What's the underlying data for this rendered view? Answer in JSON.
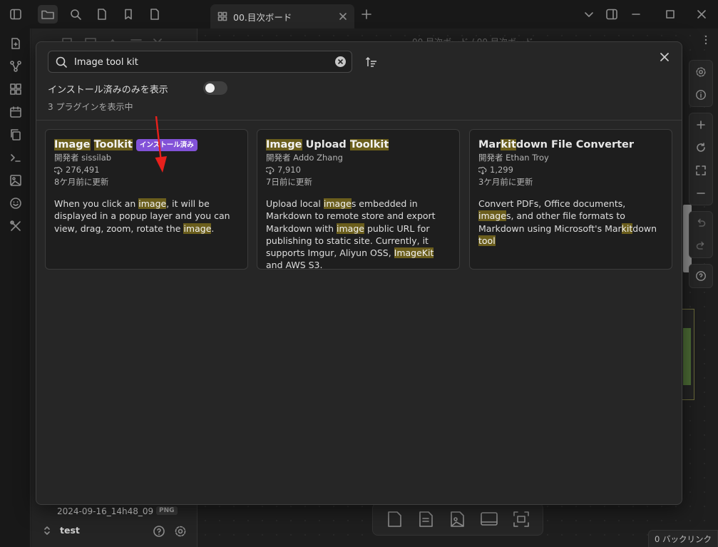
{
  "tabbar": {
    "tab_title": "00.目次ボード"
  },
  "sidebar": {
    "file_name": "2024-09-16_14h48_09",
    "file_badge": "PNG",
    "vault_name": "test"
  },
  "editor": {
    "breadcrumb": "00.目次ボード / 00.目次ボード",
    "backlinks": "0 バックリンク"
  },
  "plugin_browser": {
    "search": {
      "value": "Image tool kit",
      "placeholder": ""
    },
    "installed_only_label": "インストール済みのみを表示",
    "installed_only_enabled": false,
    "count_text": "3 プラグインを表示中",
    "plugins": [
      {
        "title_parts": [
          {
            "text": "Image",
            "hl": true
          },
          {
            "text": " ",
            "hl": false
          },
          {
            "text": "Toolkit",
            "hl": true
          }
        ],
        "installed_badge": "インストール済み",
        "author": "開発者 sissilab",
        "downloads": "276,491",
        "updated": "8ケ月前に更新",
        "description_parts": [
          {
            "text": "When you click an ",
            "hl": false
          },
          {
            "text": "image",
            "hl": true
          },
          {
            "text": ", it will be displayed in a popup layer and you can view, drag, zoom, rotate the ",
            "hl": false
          },
          {
            "text": "image",
            "hl": true
          },
          {
            "text": ".",
            "hl": false
          }
        ]
      },
      {
        "title_parts": [
          {
            "text": "Image",
            "hl": true
          },
          {
            "text": " Upload ",
            "hl": false
          },
          {
            "text": "Toolkit",
            "hl": true
          }
        ],
        "installed_badge": "",
        "author": "開発者 Addo Zhang",
        "downloads": "7,910",
        "updated": "7日前に更新",
        "description_parts": [
          {
            "text": "Upload local ",
            "hl": false
          },
          {
            "text": "image",
            "hl": true
          },
          {
            "text": "s embedded in Markdown to remote store and export Markdown with ",
            "hl": false
          },
          {
            "text": "image",
            "hl": true
          },
          {
            "text": " public URL for publishing to static site. Currently, it supports Imgur, Aliyun OSS, ",
            "hl": false
          },
          {
            "text": "ImageKit",
            "hl": true
          },
          {
            "text": " and AWS S3.",
            "hl": false
          }
        ]
      },
      {
        "title_parts": [
          {
            "text": "Mar",
            "hl": false
          },
          {
            "text": "kit",
            "hl": true
          },
          {
            "text": "down File Converter",
            "hl": false
          }
        ],
        "installed_badge": "",
        "author": "開発者 Ethan Troy",
        "downloads": "1,299",
        "updated": "3ケ月前に更新",
        "description_parts": [
          {
            "text": "Convert PDFs, Office documents, ",
            "hl": false
          },
          {
            "text": "image",
            "hl": true
          },
          {
            "text": "s, and other file formats to Markdown using Microsoft's Mar",
            "hl": false
          },
          {
            "text": "kit",
            "hl": true
          },
          {
            "text": "down ",
            "hl": false
          },
          {
            "text": "tool",
            "hl": true
          }
        ]
      }
    ]
  },
  "colors": {
    "accent_badge": "#8252d8",
    "highlight": "#6b5e1c",
    "annotation_arrow": "#e8201c"
  },
  "icons": {
    "ribbon": [
      "file-plus-icon",
      "graph-icon",
      "canvas-grid-icon",
      "calendar-icon",
      "copy-icon",
      "terminal-icon",
      "image-icon",
      "smiley-icon",
      "tools-icon"
    ]
  }
}
